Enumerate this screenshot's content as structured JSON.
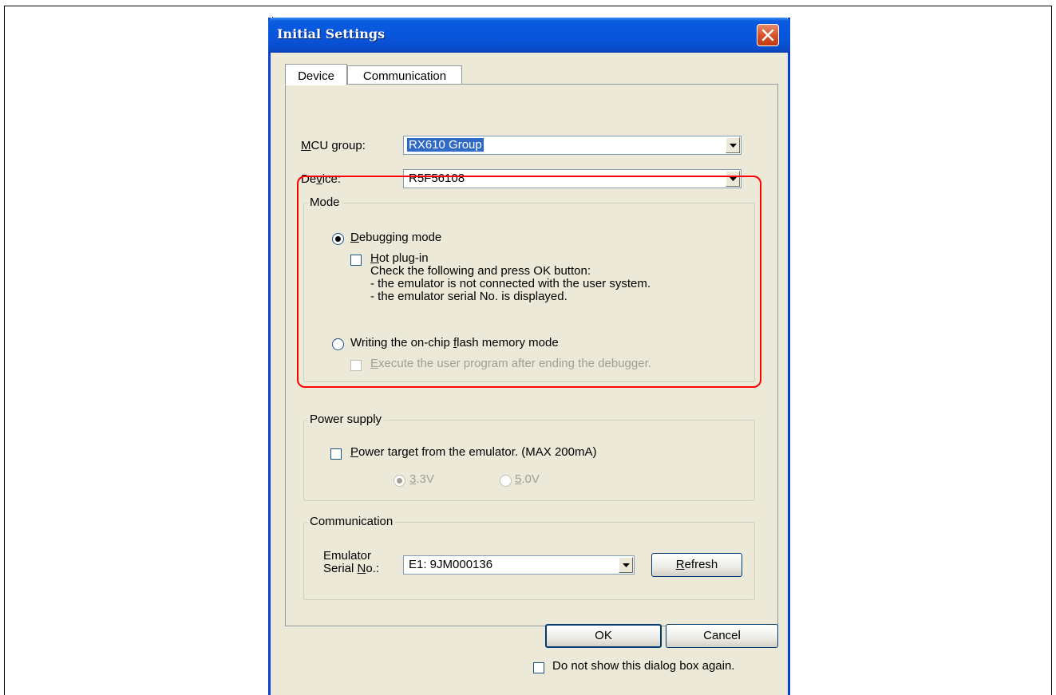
{
  "window": {
    "title": "Initial Settings"
  },
  "tabs": [
    {
      "label": "Device",
      "active": true
    },
    {
      "label": "Communication",
      "active": false
    }
  ],
  "device_tab": {
    "mcu_group": {
      "label_pre": "M",
      "label_rest": "CU group:",
      "value": "RX610 Group"
    },
    "device": {
      "label_pre": "De",
      "label_u": "v",
      "label_rest": "ice:",
      "value": "R5F56108"
    }
  },
  "mode": {
    "title": "Mode",
    "debugging": {
      "pre": "",
      "u": "D",
      "rest": "ebugging mode",
      "selected": true
    },
    "hot_plug": {
      "pre": "",
      "u": "H",
      "rest": "ot plug-in",
      "checked": false
    },
    "hot_plug_info": [
      "Check the following and press OK button:",
      "- the emulator is not connected with the user system.",
      "- the emulator serial No. is displayed."
    ],
    "writing": {
      "pre": "Writing the on-chip ",
      "u": "f",
      "rest": "lash memory mode",
      "selected": false
    },
    "execute": {
      "pre": "",
      "u": "E",
      "rest": "xecute the user program after ending the debugger.",
      "checked": false,
      "enabled": false
    }
  },
  "power_supply": {
    "title": "Power supply",
    "power_target": {
      "u": "P",
      "rest": "ower target from the emulator. (MAX 200mA)",
      "checked": false
    },
    "v33": {
      "u": "3",
      "rest": ".3V",
      "selected": true,
      "enabled": false
    },
    "v50": {
      "u": "5",
      "rest": ".0V",
      "selected": false,
      "enabled": false
    }
  },
  "communication": {
    "title": "Communication",
    "serial_label_line1": "Emulator",
    "serial_label_line2_pre": "Serial ",
    "serial_label_line2_u": "N",
    "serial_label_line2_rest": "o.:",
    "serial_value": "E1: 9JM000136",
    "refresh": {
      "u": "R",
      "rest": "efresh"
    }
  },
  "buttons": {
    "ok": "OK",
    "cancel": "Cancel"
  },
  "dont_show": {
    "label": "Do not show this dialog box again.",
    "checked": false
  },
  "colors": {
    "title_bar": "#0a5ce0",
    "highlight": "#ff0000",
    "selection": "#316ac5",
    "dialog_bg": "#ece9d8"
  }
}
